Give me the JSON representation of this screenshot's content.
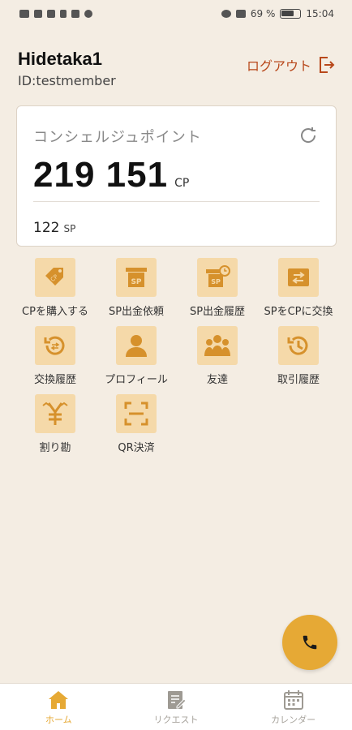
{
  "status_bar": {
    "battery_text": "69 %",
    "battery_level": 0.69,
    "time": "15:04"
  },
  "user": {
    "name": "Hidetaka1",
    "id_text": "ID:testmember"
  },
  "logout_label": "ログアウト",
  "card": {
    "title": "コンシェルジュポイント",
    "cp_value": "219 151",
    "cp_unit": "CP",
    "sp_value": "122",
    "sp_unit": "SP"
  },
  "menu": [
    {
      "label": "CPを購入する",
      "icon": "cp-tag-icon"
    },
    {
      "label": "SP出金依頼",
      "icon": "sp-withdraw-icon"
    },
    {
      "label": "SP出金履歴",
      "icon": "sp-history-icon"
    },
    {
      "label": "SPをCPに交換",
      "icon": "exchange-icon"
    },
    {
      "label": "交換履歴",
      "icon": "exchange-history-icon"
    },
    {
      "label": "プロフィール",
      "icon": "person-icon"
    },
    {
      "label": "友達",
      "icon": "friends-icon"
    },
    {
      "label": "取引履歴",
      "icon": "transaction-history-icon"
    },
    {
      "label": "割り勘",
      "icon": "yen-split-icon"
    },
    {
      "label": "QR決済",
      "icon": "qr-scan-icon"
    }
  ],
  "fab_icon": "phone-icon",
  "nav": [
    {
      "label": "ホーム",
      "icon": "home-icon",
      "active": true
    },
    {
      "label": "リクエスト",
      "icon": "request-icon",
      "active": false
    },
    {
      "label": "カレンダー",
      "icon": "calendar-icon",
      "active": false
    }
  ],
  "colors": {
    "background": "#f4ede3",
    "accent": "#e6a935",
    "tile": "#f5d9a9",
    "icon": "#d6912c",
    "logout": "#b8481b"
  }
}
